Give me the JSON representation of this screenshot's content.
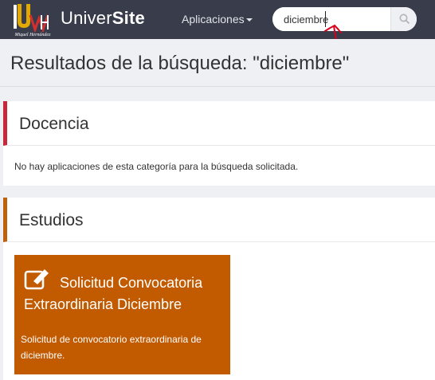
{
  "navbar": {
    "logo_text": "UNIVERSITAS Miguel Hernández",
    "brand_bold": "Univer",
    "brand_rest": "Site",
    "apps_menu_label": "Aplicaciones",
    "search": {
      "value": "diciembre",
      "icon": "search-icon"
    }
  },
  "page": {
    "title": "Resultados de la búsqueda: \"diciembre\""
  },
  "sections": {
    "docencia": {
      "title": "Docencia",
      "accent": "#c7283a",
      "empty_message": "No hay aplicaciones de esta categoría para la búsqueda solicitada."
    },
    "estudios": {
      "title": "Estudios",
      "accent": "#c0600c",
      "apps": [
        {
          "title": "Solicitud Convocatoria Extraordinaria Diciembre",
          "description": "Solicitud de convocatorio extraordinaria de diciembre.",
          "icon": "edit-icon",
          "color": "#c25a00"
        }
      ]
    }
  },
  "colors": {
    "navbar": "#383c4b",
    "background": "#eef0f3",
    "annotation": "#d9001b"
  }
}
